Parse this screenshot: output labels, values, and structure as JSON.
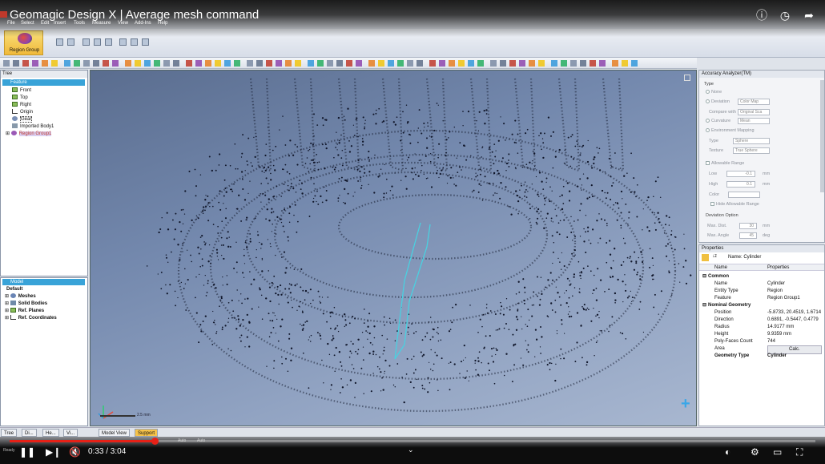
{
  "video": {
    "title": "Geomagic Design X | Average mesh command",
    "time": "0:33 / 3:04",
    "progress": 0.18
  },
  "menu": [
    "File",
    "Select",
    "Edit",
    "Insert",
    "Tools",
    "Measure",
    "View",
    "Add-Ins",
    "Help"
  ],
  "ribbon": {
    "region_group_label": "Region Group"
  },
  "tree_panel": {
    "title": "Tree",
    "header": "Feature",
    "items": [
      {
        "label": "Front",
        "type": "plane"
      },
      {
        "label": "Top",
        "type": "plane"
      },
      {
        "label": "Right",
        "type": "plane"
      },
      {
        "label": "Origin",
        "type": "origin"
      },
      {
        "label": "Gear",
        "type": "mesh"
      },
      {
        "label": "Imported Body1",
        "type": "body"
      },
      {
        "label": "Region Group1",
        "type": "region"
      }
    ]
  },
  "model_panel": {
    "header": "Model",
    "root": "Default",
    "items": [
      "Meshes",
      "Solid Bodies",
      "Ref. Planes",
      "Ref. Coordinates"
    ]
  },
  "viewport": {
    "scale_text": "2.5 mm"
  },
  "accuracy": {
    "title": "Accuracy Analyzer(TM)",
    "type_label": "Type",
    "options": [
      "None",
      "Deviation",
      "Curvature",
      "Environment Mapping"
    ],
    "deviation_value": "Color Map",
    "compare_with_label": "Compare with",
    "compare_with_value": "Original Sca",
    "curvature_value": "Mean",
    "type2_label": "Type",
    "type2_value": "Sphere",
    "texture_label": "Texture",
    "texture_value": "True Sphere",
    "allowable_label": "Allowable Range",
    "low_label": "Low",
    "low_value": "-0.1",
    "high_label": "High",
    "high_value": "0.1",
    "unit": "mm",
    "color_label": "Color",
    "hide_label": "Hide Allowable Range",
    "deviation_option_label": "Deviation Option",
    "max_dist_label": "Max. Dist.",
    "max_dist_value": "30",
    "max_angle_label": "Max. Angle",
    "max_angle_value": "45",
    "deg": "deg"
  },
  "properties": {
    "title": "Properties",
    "name_line": "Name: Cylinder",
    "col_name": "Name",
    "col_props": "Properties",
    "groups": [
      {
        "label": "Common",
        "rows": [
          {
            "name": "Name",
            "value": "Cylinder"
          },
          {
            "name": "Entity Type",
            "value": "Region"
          },
          {
            "name": "Feature",
            "value": "Region Group1"
          }
        ]
      },
      {
        "label": "Nominal Geometry",
        "rows": [
          {
            "name": "Position",
            "value": "-5.8733, 20.4519, 1.6714"
          },
          {
            "name": "Direction",
            "value": "0.6891, -0.5447, 0.4779"
          },
          {
            "name": "Radius",
            "value": "14.9177 mm"
          },
          {
            "name": "Height",
            "value": "9.9359 mm"
          },
          {
            "name": "Poly-Faces Count",
            "value": "744"
          },
          {
            "name": "Area",
            "value": "Calc."
          },
          {
            "name": "Geometry Type",
            "value": "Cylinder"
          }
        ]
      }
    ]
  },
  "bottom_tabs": [
    "Tree",
    "Di...",
    "He...",
    "Vi...",
    "Model View",
    "Support"
  ],
  "status": {
    "ready": "Ready",
    "auto1": "Auto",
    "auto2": "Auto"
  },
  "colors": {
    "accent": "#39a3d8",
    "progress": "#e62117",
    "viewport": "#7388ad"
  }
}
